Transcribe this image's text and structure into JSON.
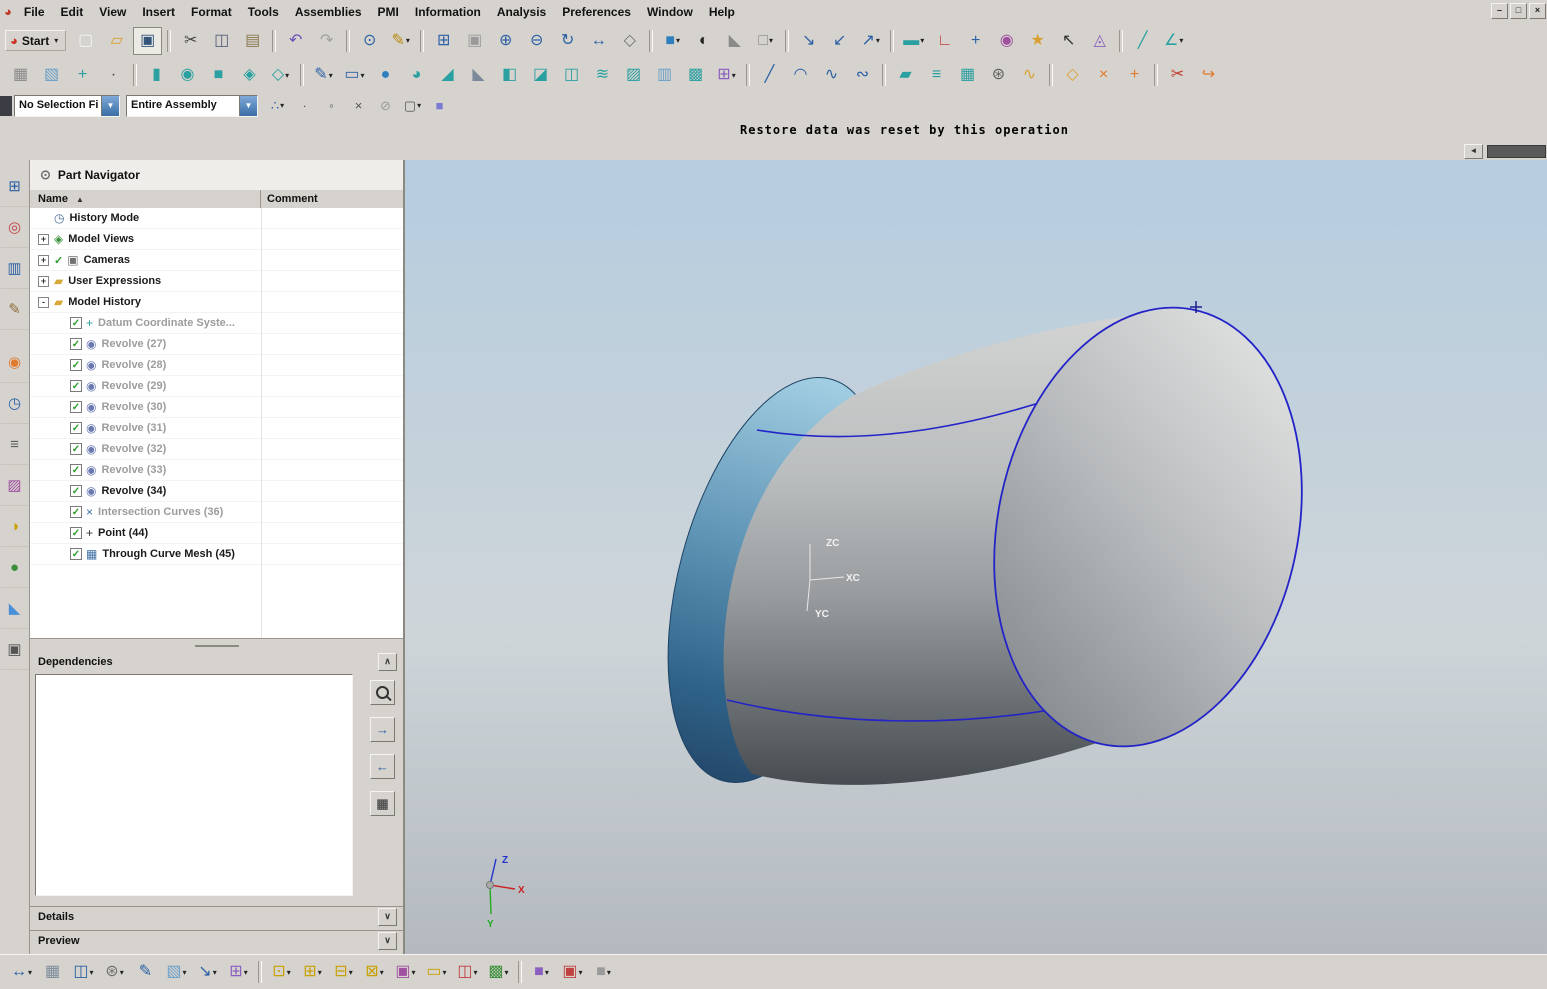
{
  "window": {
    "app_icon_glyph": "◕",
    "controls": [
      {
        "name": "minimize-button",
        "glyph": "–"
      },
      {
        "name": "restore-button",
        "glyph": "□"
      },
      {
        "name": "close-button",
        "glyph": "×"
      }
    ]
  },
  "menubar": {
    "items": [
      "File",
      "Edit",
      "View",
      "Insert",
      "Format",
      "Tools",
      "Assemblies",
      "PMI",
      "Information",
      "Analysis",
      "Preferences",
      "Window",
      "Help"
    ]
  },
  "ui_glyphs": {
    "dropdown": "▾",
    "checkbox_check": "✓",
    "check_mark": "✓",
    "expand": "+",
    "collapse": "-"
  },
  "toolbar_top": {
    "start": {
      "label": "Start"
    },
    "icons": [
      {
        "name": "new-part",
        "glyph": "▢",
        "color": "#f4f4f1"
      },
      {
        "name": "open",
        "glyph": "▱",
        "color": "#d8a030"
      },
      {
        "name": "save",
        "glyph": "▣",
        "color": "#35567c",
        "pressed": true
      },
      {
        "sep": true
      },
      {
        "name": "cut",
        "glyph": "✂",
        "color": "#444444"
      },
      {
        "name": "copy",
        "glyph": "◫",
        "color": "#55607a"
      },
      {
        "name": "paste",
        "glyph": "▤",
        "color": "#8a7a50"
      },
      {
        "sep": true
      },
      {
        "name": "undo",
        "glyph": "↶",
        "color": "#6a50b8"
      },
      {
        "name": "redo",
        "glyph": "↷",
        "color": "#a0a0a0"
      },
      {
        "sep": true
      },
      {
        "name": "command-info",
        "glyph": "⊙",
        "color": "#2a5fa5"
      },
      {
        "name": "command-finder",
        "glyph": "✎",
        "color": "#b8860b",
        "dd": true
      },
      {
        "sep": true
      },
      {
        "name": "fit-view",
        "glyph": "⊞",
        "color": "#2a5fa5"
      },
      {
        "name": "zoom-box",
        "glyph": "▣",
        "color": "#9a9a9a"
      },
      {
        "name": "zoom-in",
        "glyph": "⊕",
        "color": "#2a5fa5"
      },
      {
        "name": "zoom-out",
        "glyph": "⊖",
        "color": "#2a5fa5"
      },
      {
        "name": "rotate-view",
        "glyph": "↻",
        "color": "#2a5fa5"
      },
      {
        "name": "pan-view",
        "glyph": "↔",
        "color": "#2a5fa5"
      },
      {
        "name": "perspective-view",
        "glyph": "◇",
        "color": "#707070"
      },
      {
        "sep": true
      },
      {
        "name": "shaded-display",
        "glyph": "■",
        "color": "#2f7fbf",
        "dd": true
      },
      {
        "name": "rendering-style",
        "glyph": "◐",
        "color": "#222222"
      },
      {
        "name": "face-analysis",
        "glyph": "◣",
        "color": "#8a8a8a"
      },
      {
        "name": "background-color",
        "glyph": "□",
        "color": "#888888",
        "dd": true
      },
      {
        "sep": true
      },
      {
        "name": "orient-view-top",
        "glyph": "↘",
        "color": "#2a5fa5"
      },
      {
        "name": "orient-view-front",
        "glyph": "↙",
        "color": "#2a5fa5"
      },
      {
        "name": "orient-view-iso",
        "glyph": "↗",
        "color": "#2a5fa5",
        "dd": true
      },
      {
        "sep": true
      },
      {
        "name": "work-layer",
        "glyph": "▬",
        "color": "#2aa0a0",
        "dd": true
      },
      {
        "name": "view-triad",
        "glyph": "∟",
        "color": "#c04040"
      },
      {
        "name": "orient-csys",
        "glyph": "+",
        "color": "#2a5fa5"
      },
      {
        "name": "high-quality-image",
        "glyph": "◉",
        "color": "#a050a0"
      },
      {
        "name": "visual-effects",
        "glyph": "★",
        "color": "#d8a030"
      },
      {
        "name": "selection-cursor",
        "glyph": "↖",
        "color": "#333333"
      },
      {
        "name": "material-analysis",
        "glyph": "◬",
        "color": "#8a5fc0"
      },
      {
        "sep": true
      },
      {
        "name": "measure-distance",
        "glyph": "╱",
        "color": "#2aa0a0"
      },
      {
        "name": "measure-angle",
        "glyph": "∠",
        "color": "#2aa0a0",
        "dd": true
      }
    ]
  },
  "toolbar_second": {
    "icons": [
      {
        "name": "process-navigator",
        "glyph": "▦",
        "color": "#8a8a8a"
      },
      {
        "name": "datum-plane",
        "glyph": "▧",
        "color": "#6aa0c8"
      },
      {
        "name": "datum-csys",
        "glyph": "+",
        "color": "#2aa0a0"
      },
      {
        "name": "point-tool",
        "glyph": "∙",
        "color": "#444444"
      },
      {
        "sep": true
      },
      {
        "name": "extrude",
        "glyph": "▮",
        "color": "#2aa0a0"
      },
      {
        "name": "revolve",
        "glyph": "◉",
        "color": "#2aa0a0"
      },
      {
        "name": "block",
        "glyph": "■",
        "color": "#2aa0a0"
      },
      {
        "name": "unite",
        "glyph": "◈",
        "color": "#2aa0a0"
      },
      {
        "name": "subtract",
        "glyph": "◇",
        "color": "#2aa0a0",
        "dd": true
      },
      {
        "sep": true
      },
      {
        "name": "sketch",
        "glyph": "✎",
        "color": "#2a5fa5",
        "dd": true
      },
      {
        "name": "rectangle-tool",
        "glyph": "▭",
        "color": "#2a5fa5",
        "dd": true
      },
      {
        "name": "edge-blend",
        "glyph": "●",
        "color": "#2f7fbf"
      },
      {
        "name": "face-blend",
        "glyph": "◕",
        "color": "#2aa0a0"
      },
      {
        "name": "chamfer",
        "glyph": "◢",
        "color": "#2aa0a0"
      },
      {
        "name": "draft",
        "glyph": "◣",
        "color": "#7a8a9a"
      },
      {
        "name": "shell",
        "glyph": "◧",
        "color": "#2aa0a0"
      },
      {
        "name": "trim-body",
        "glyph": "◪",
        "color": "#2aa0a0"
      },
      {
        "name": "split-body",
        "glyph": "◫",
        "color": "#2aa0a0"
      },
      {
        "name": "sew",
        "glyph": "≋",
        "color": "#2aa0a0"
      },
      {
        "name": "patch",
        "glyph": "▨",
        "color": "#2aa0a0"
      },
      {
        "name": "offset-surface",
        "glyph": "▥",
        "color": "#6aa0c8"
      },
      {
        "name": "thicken",
        "glyph": "▩",
        "color": "#2aa0a0"
      },
      {
        "name": "pattern-feature",
        "glyph": "⊞",
        "color": "#8a5fc0",
        "dd": true
      },
      {
        "sep": true
      },
      {
        "name": "line",
        "glyph": "╱",
        "color": "#2a5fa5"
      },
      {
        "name": "arc",
        "glyph": "◠",
        "color": "#2a5fa5"
      },
      {
        "name": "studio-spline",
        "glyph": "∿",
        "color": "#2a5fa5"
      },
      {
        "name": "fit-curve",
        "glyph": "∾",
        "color": "#2a5fa5"
      },
      {
        "sep": true
      },
      {
        "name": "ruled-surface",
        "glyph": "▰",
        "color": "#2aa0a0"
      },
      {
        "name": "through-curves",
        "glyph": "≡",
        "color": "#2aa0a0"
      },
      {
        "name": "through-curve-mesh",
        "glyph": "▦",
        "color": "#2aa0a0"
      },
      {
        "name": "swept",
        "glyph": "⊛",
        "color": "#606060"
      },
      {
        "name": "styled-sweep",
        "glyph": "∿",
        "color": "#d8a030"
      },
      {
        "sep": true
      },
      {
        "name": "n-sided-surface",
        "glyph": "◇",
        "color": "#d8a030"
      },
      {
        "name": "x-form",
        "glyph": "×",
        "color": "#e07a2c"
      },
      {
        "name": "i-form",
        "glyph": "+",
        "color": "#e07a2c"
      },
      {
        "sep": true
      },
      {
        "name": "snip-surface",
        "glyph": "✂",
        "color": "#c0392b"
      },
      {
        "name": "edit-surface",
        "glyph": "↪",
        "color": "#e07a2c"
      }
    ]
  },
  "selection_bar": {
    "filter_value": "No Selection Fi",
    "scope_value": "Entire Assembly",
    "icons": [
      {
        "name": "snap-point-toggle",
        "glyph": "∴",
        "color": "#2a5fa5",
        "dd": true
      },
      {
        "name": "snap-end-point",
        "glyph": "∙",
        "color": "#555555"
      },
      {
        "name": "snap-midpoint",
        "glyph": "◦",
        "color": "#555555"
      },
      {
        "name": "snap-intersection",
        "glyph": "×",
        "color": "#555555"
      },
      {
        "name": "no-snap",
        "glyph": "⊘",
        "color": "#9a9a9a"
      },
      {
        "name": "rectangle-select",
        "glyph": "▢",
        "color": "#555555",
        "dd": true
      },
      {
        "name": "shaded-toggle",
        "glyph": "■",
        "color": "#7a7ad0"
      }
    ]
  },
  "status_bar": {
    "message": "Restore data was reset by this operation"
  },
  "graphics_scrollbar": {
    "left_arrow_glyph": "◄"
  },
  "resource_bar": {
    "tabs": [
      {
        "name": "assembly-navigator",
        "glyph": "⊞",
        "color": "#2a5fa5"
      },
      {
        "name": "constraint-navigator",
        "glyph": "◎",
        "color": "#c04040"
      },
      {
        "name": "part-navigator",
        "glyph": "▥",
        "color": "#2a5fa5"
      },
      {
        "name": "operation-navigator",
        "glyph": "✎",
        "color": "#8a6d3b"
      },
      {
        "gap": true
      },
      {
        "name": "reuse-library",
        "glyph": "◉",
        "color": "#e07a2c"
      },
      {
        "name": "hd3d-tools",
        "glyph": "◷",
        "color": "#2a5fa5"
      },
      {
        "name": "web-browser",
        "glyph": "≡",
        "color": "#606060"
      },
      {
        "name": "palette",
        "glyph": "▨",
        "color": "#a050a0"
      },
      {
        "name": "visualization",
        "glyph": "◑",
        "color": "#c8a000"
      },
      {
        "name": "roles",
        "glyph": "●",
        "color": "#3a8f3a"
      },
      {
        "name": "system-scenes",
        "glyph": "◣",
        "color": "#4a90d9"
      },
      {
        "name": "windows",
        "glyph": "▣",
        "color": "#555555"
      }
    ]
  },
  "part_navigator": {
    "title": "Part Navigator",
    "title_icon_glyph": "⊙",
    "columns": {
      "name": "Name",
      "comment": "Comment"
    },
    "sort_icon_glyph": "▲",
    "dependencies_label": "Dependencies",
    "details_label": "Details",
    "preview_label": "Preview",
    "collapse_glyph": "∧",
    "expand_glyph": "∨",
    "tree": [
      {
        "label": "History Mode",
        "name": "history-mode",
        "glyph": "◷",
        "color": "#4a6a9a",
        "expander": null,
        "check": null,
        "indent": 0,
        "muted": false
      },
      {
        "label": "Model Views",
        "name": "model-views",
        "glyph": "◈",
        "color": "#3a8f3a",
        "expander": "plus",
        "check": null,
        "indent": 0,
        "muted": false
      },
      {
        "label": "Cameras",
        "name": "cameras",
        "glyph": "▣",
        "color": "#707070",
        "expander": "plus",
        "check": "mark",
        "indent": 0,
        "muted": false
      },
      {
        "label": "User Expressions",
        "name": "user-expressions",
        "glyph": "▰",
        "color": "#d8a838",
        "expander": "plus",
        "check": null,
        "indent": 0,
        "muted": false
      },
      {
        "label": "Model History",
        "name": "model-history",
        "glyph": "▰",
        "color": "#d8a838",
        "expander": "minus",
        "check": null,
        "indent": 0,
        "muted": false
      },
      {
        "label": "Datum Coordinate Syste...",
        "name": "datum-coordinate-system",
        "glyph": "+",
        "color": "#2aa0a0",
        "expander": null,
        "check": "box",
        "indent": 1,
        "muted": true
      },
      {
        "label": "Revolve (27)",
        "name": "revolve-27",
        "glyph": "◉",
        "color": "#6a7ab0",
        "expander": null,
        "check": "box",
        "indent": 1,
        "muted": true
      },
      {
        "label": "Revolve (28)",
        "name": "revolve-28",
        "glyph": "◉",
        "color": "#6a7ab0",
        "expander": null,
        "check": "box",
        "indent": 1,
        "muted": true
      },
      {
        "label": "Revolve (29)",
        "name": "revolve-29",
        "glyph": "◉",
        "color": "#6a7ab0",
        "expander": null,
        "check": "box",
        "indent": 1,
        "muted": true
      },
      {
        "label": "Revolve (30)",
        "name": "revolve-30",
        "glyph": "◉",
        "color": "#6a7ab0",
        "expander": null,
        "check": "box",
        "indent": 1,
        "muted": true
      },
      {
        "label": "Revolve (31)",
        "name": "revolve-31",
        "glyph": "◉",
        "color": "#6a7ab0",
        "expander": null,
        "check": "box",
        "indent": 1,
        "muted": true
      },
      {
        "label": "Revolve (32)",
        "name": "revolve-32",
        "glyph": "◉",
        "color": "#6a7ab0",
        "expander": null,
        "check": "box",
        "indent": 1,
        "muted": true
      },
      {
        "label": "Revolve (33)",
        "name": "revolve-33",
        "glyph": "◉",
        "color": "#6a7ab0",
        "expander": null,
        "check": "box",
        "indent": 1,
        "muted": true
      },
      {
        "label": "Revolve (34)",
        "name": "revolve-34",
        "glyph": "◉",
        "color": "#6a7ab0",
        "expander": null,
        "check": "box",
        "indent": 1,
        "muted": false
      },
      {
        "label": "Intersection Curves (36)",
        "name": "intersection-curves-36",
        "glyph": "×",
        "color": "#3a6ea5",
        "expander": null,
        "check": "box",
        "indent": 1,
        "muted": true
      },
      {
        "label": "Point (44)",
        "name": "point-44",
        "glyph": "+",
        "color": "#333333",
        "expander": null,
        "check": "box",
        "indent": 1,
        "muted": false
      },
      {
        "label": "Through Curve Mesh (45)",
        "name": "through-curve-mesh-45",
        "glyph": "▦",
        "color": "#3a6ea5",
        "expander": null,
        "check": "box",
        "indent": 1,
        "muted": false
      }
    ]
  },
  "viewport": {
    "csys": {
      "zc": "ZC",
      "xc": "XC",
      "yc": "YC"
    },
    "wcs": {
      "z": "Z",
      "x": "X",
      "y": "Y"
    }
  },
  "bottom_toolbar": {
    "icons": [
      {
        "name": "move-component",
        "glyph": "↔",
        "color": "#2a5fa5",
        "dd": true
      },
      {
        "name": "assembly-constraints",
        "glyph": "▦",
        "color": "#7a8a9a"
      },
      {
        "name": "add-component",
        "glyph": "◫",
        "color": "#2a5fa5",
        "dd": true
      },
      {
        "name": "wave-geometry-linker",
        "glyph": "⊛",
        "color": "#707070",
        "dd": true
      },
      {
        "name": "sketch-in-task",
        "glyph": "✎",
        "color": "#2a5fa5"
      },
      {
        "name": "datum-plane-bottom",
        "glyph": "▧",
        "color": "#6aa0c8",
        "dd": true
      },
      {
        "name": "export-geometry",
        "glyph": "↘",
        "color": "#2a5fa5",
        "dd": true
      },
      {
        "name": "tools-group",
        "glyph": "⊞",
        "color": "#8a5fc0",
        "dd": true
      },
      {
        "sep": true
      },
      {
        "name": "hole",
        "glyph": "⊡",
        "color": "#c8a000",
        "dd": true
      },
      {
        "name": "boss",
        "glyph": "⊞",
        "color": "#c8a000",
        "dd": true
      },
      {
        "name": "pocket",
        "glyph": "⊟",
        "color": "#c8a000",
        "dd": true
      },
      {
        "name": "pad",
        "glyph": "⊠",
        "color": "#c8a000",
        "dd": true
      },
      {
        "name": "emboss",
        "glyph": "▣",
        "color": "#a050a0",
        "dd": true
      },
      {
        "name": "slot",
        "glyph": "▭",
        "color": "#c8a000",
        "dd": true
      },
      {
        "name": "groove",
        "glyph": "◫",
        "color": "#c04040",
        "dd": true
      },
      {
        "name": "feature-group",
        "glyph": "▩",
        "color": "#3a8f3a",
        "dd": true
      },
      {
        "sep": true
      },
      {
        "name": "show-product-outline",
        "glyph": "■",
        "color": "#8a5fc0",
        "dd": true
      },
      {
        "name": "assembly-cut",
        "glyph": "▣",
        "color": "#c04040",
        "dd": true
      },
      {
        "name": "work-section",
        "glyph": "■",
        "color": "#9a9a9a",
        "dd": true
      }
    ]
  }
}
